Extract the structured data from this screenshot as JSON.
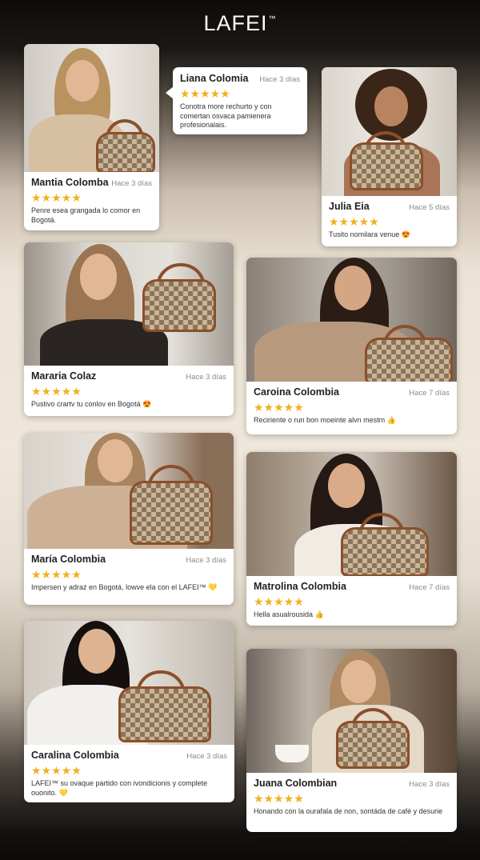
{
  "brand": {
    "name": "LAFEI",
    "tm": "™"
  },
  "bubble_review": {
    "name": "Liana Colomia",
    "time": "Hace 3 días",
    "stars": "★★★★★",
    "text": "Conotra more rechurto y con comertan osvaca pamienera profesionalais."
  },
  "reviews": [
    {
      "name": "Mantia Colomba",
      "time": "Hace 3 días",
      "stars": "★★★★★",
      "text": "Penre esea grangada lo comor en Bogotá."
    },
    {
      "name": "Julia Eia",
      "time": "Hace 5 días",
      "stars": "★★★★★",
      "text": "Tusito nomilara venue 😍"
    },
    {
      "name": "Mararia Colaz",
      "time": "Hace 3 días",
      "stars": "★★★★★",
      "text": "Pustivo crartv tu conlov en Bogotá 😍"
    },
    {
      "name": "Caroina Colombia",
      "time": "Hace 7 días",
      "stars": "★★★★★",
      "text": "Reciriente o run bon moeinte alvn mestm 👍"
    },
    {
      "name": "María Colombia",
      "time": "Hace 3 días",
      "stars": "★★★★★",
      "text": "Impersen y adraż en Bogotá, lowve ela con el LAFEI™ 💛"
    },
    {
      "name": "Matrolina Colombia",
      "time": "Hace 7 días",
      "stars": "★★★★★",
      "text": "Hella asualrousida 👍"
    },
    {
      "name": "Caralina Colombia",
      "time": "Hace 3 días",
      "stars": "★★★★★",
      "text": "LAFEI™ su ovaque partido con ivondicionis y complete ouonito. 💛"
    },
    {
      "name": "Juana Colombian",
      "time": "Hace 3 días",
      "stars": "★★★★★",
      "text": "Honando con la ourafala de non, sontáda de café y desurie"
    }
  ]
}
